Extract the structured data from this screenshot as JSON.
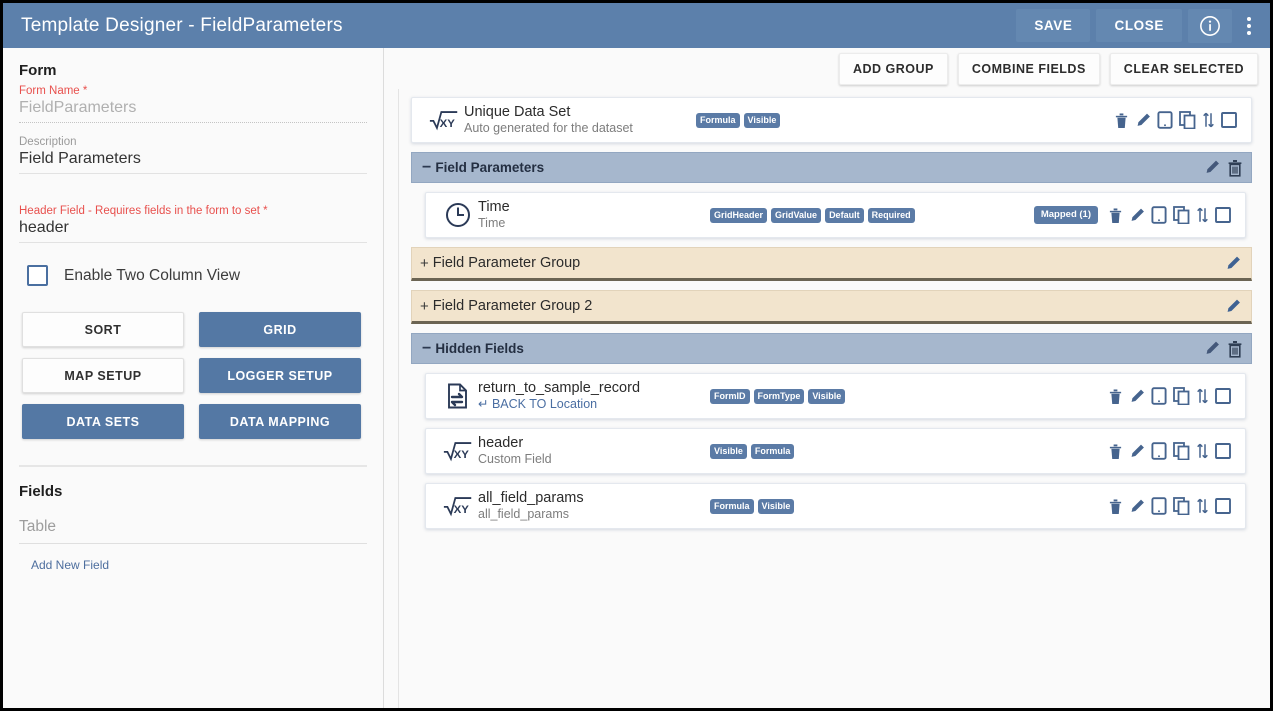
{
  "titlebar": {
    "title": "Template Designer - FieldParameters",
    "save_label": "SAVE",
    "close_label": "CLOSE",
    "info_icon": "info-circle-icon",
    "menu_icon": "kebab-menu-icon",
    "background_color": "#5c80ab"
  },
  "left_panel": {
    "form_section_title": "Form",
    "form_name_label": "Form Name *",
    "form_name_value": "FieldParameters",
    "description_label": "Description",
    "description_value": "Field Parameters",
    "header_field_label": "Header Field - Requires fields in the form to set *",
    "header_field_value": "header",
    "two_column_label": "Enable Two Column View",
    "two_column_checked": false,
    "buttons": [
      {
        "label": "SORT",
        "style": "light"
      },
      {
        "label": "GRID",
        "style": "blue"
      },
      {
        "label": "MAP SETUP",
        "style": "light"
      },
      {
        "label": "LOGGER SETUP",
        "style": "blue"
      },
      {
        "label": "DATA SETS",
        "style": "blue"
      },
      {
        "label": "DATA MAPPING",
        "style": "blue"
      }
    ],
    "fields_section_title": "Fields",
    "table_placeholder": "Table",
    "add_new_field_label": "Add New Field"
  },
  "right_panel": {
    "toolbar": {
      "add_group_label": "ADD GROUP",
      "combine_fields_label": "COMBINE FIELDS",
      "clear_selected_label": "CLEAR SELECTED"
    },
    "items": [
      {
        "kind": "field",
        "icon": "formula-sqrt-xy-icon",
        "title": "Unique Data Set",
        "subtitle": "Auto generated for the dataset",
        "subtitle_link": false,
        "badges": [
          "Formula",
          "Visible"
        ],
        "mapped_badge": "",
        "indented": false
      },
      {
        "kind": "group-open",
        "toggle": "−",
        "name": "Field Parameters"
      },
      {
        "kind": "field",
        "icon": "clock-icon",
        "title": "Time",
        "subtitle": "Time",
        "subtitle_link": false,
        "badges": [
          "GridHeader",
          "GridValue",
          "Default",
          "Required"
        ],
        "mapped_badge": "Mapped  (1)",
        "indented": true
      },
      {
        "kind": "group-collapsed",
        "toggle": "+",
        "name": "Field Parameter Group"
      },
      {
        "kind": "group-collapsed",
        "toggle": "+",
        "name": "Field Parameter Group 2"
      },
      {
        "kind": "group-open",
        "toggle": "−",
        "name": "Hidden Fields"
      },
      {
        "kind": "field",
        "icon": "document-return-icon",
        "title": "return_to_sample_record",
        "subtitle": "↵ BACK TO Location",
        "subtitle_link": true,
        "badges": [
          "FormID",
          "FormType",
          "Visible"
        ],
        "mapped_badge": "",
        "indented": true
      },
      {
        "kind": "field",
        "icon": "formula-sqrt-xy-icon",
        "title": "header",
        "subtitle": "Custom Field",
        "subtitle_link": false,
        "badges": [
          "Visible",
          "Formula"
        ],
        "mapped_badge": "",
        "indented": true
      },
      {
        "kind": "field",
        "icon": "formula-sqrt-xy-icon",
        "title": "all_field_params",
        "subtitle": "all_field_params",
        "subtitle_link": false,
        "badges": [
          "Formula",
          "Visible"
        ],
        "mapped_badge": "",
        "indented": true
      }
    ],
    "row_action_icons": [
      "trash-icon",
      "pencil-icon",
      "tablet-icon",
      "copy-icon",
      "reorder-arrows-icon",
      "select-checkbox-icon"
    ],
    "group_action_icons": [
      "pencil-icon",
      "trash-icon"
    ]
  },
  "colors": {
    "title_bar": "#5c80ab",
    "badge": "#5b7ba6",
    "group_header": "#a6b7cd",
    "group_collapsed": "#f2e4cd",
    "accent_button": "#5478a4",
    "required_label": "#e8504d"
  }
}
